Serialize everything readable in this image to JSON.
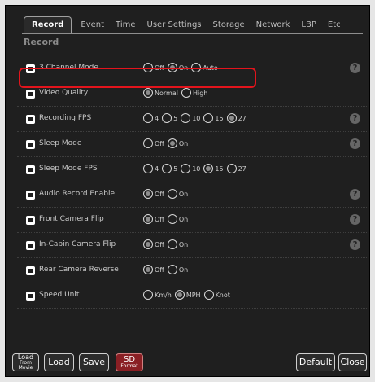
{
  "tabs": [
    "Record",
    "Event",
    "Time",
    "User Settings",
    "Storage",
    "Network",
    "LBP",
    "Etc"
  ],
  "section_title": "Record",
  "rows": [
    {
      "label": "3 Channel Mode",
      "options": [
        "Off",
        "On",
        "Auto"
      ],
      "selected": 1,
      "help": "?"
    },
    {
      "label": "Video Quality",
      "options": [
        "Normal",
        "High"
      ],
      "selected": 0,
      "help": ""
    },
    {
      "label": "Recording FPS",
      "options": [
        "4",
        "5",
        "10",
        "15",
        "27"
      ],
      "selected": 4,
      "help": "?"
    },
    {
      "label": "Sleep Mode",
      "options": [
        "Off",
        "On"
      ],
      "selected": 1,
      "help": "?"
    },
    {
      "label": "Sleep Mode FPS",
      "options": [
        "4",
        "5",
        "10",
        "15",
        "27"
      ],
      "selected": 3,
      "help": ""
    },
    {
      "label": "Audio Record Enable",
      "options": [
        "Off",
        "On"
      ],
      "selected": 0,
      "help": "?"
    },
    {
      "label": "Front Camera Flip",
      "options": [
        "Off",
        "On"
      ],
      "selected": 0,
      "help": "?"
    },
    {
      "label": "In-Cabin Camera Flip",
      "options": [
        "Off",
        "On"
      ],
      "selected": 0,
      "help": "?"
    },
    {
      "label": "Rear Camera Reverse",
      "options": [
        "Off",
        "On"
      ],
      "selected": 0,
      "help": ""
    },
    {
      "label": "Speed Unit",
      "options": [
        "Km/h",
        "MPH",
        "Knot"
      ],
      "selected": 1,
      "help": ""
    }
  ],
  "buttons": {
    "load_from_movie_line1": "Load",
    "load_from_movie_line2": "From Movie",
    "load": "Load",
    "save": "Save",
    "sd_format_line1": "SD",
    "sd_format_line2": "Format",
    "default": "Default",
    "close": "Close"
  },
  "colors": {
    "highlight": "#e3141c",
    "sd_button": "#8a1f24"
  }
}
